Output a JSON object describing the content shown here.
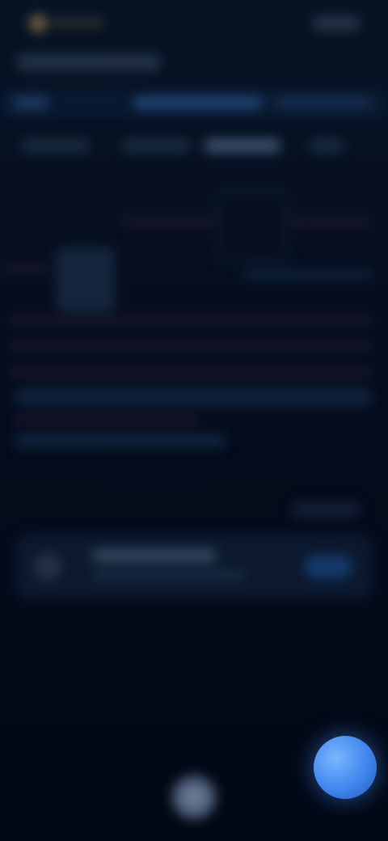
{
  "colors": {
    "background_top": "#071325",
    "background_bottom": "#020814",
    "accent_blue": "#3f86ee",
    "status_accent": "#c6a15b"
  },
  "icons": {
    "status_left": "status-indicator-icon",
    "fab": "primary-action-icon",
    "home": "home-indicator-icon",
    "card_leading": "card-avatar-icon"
  }
}
